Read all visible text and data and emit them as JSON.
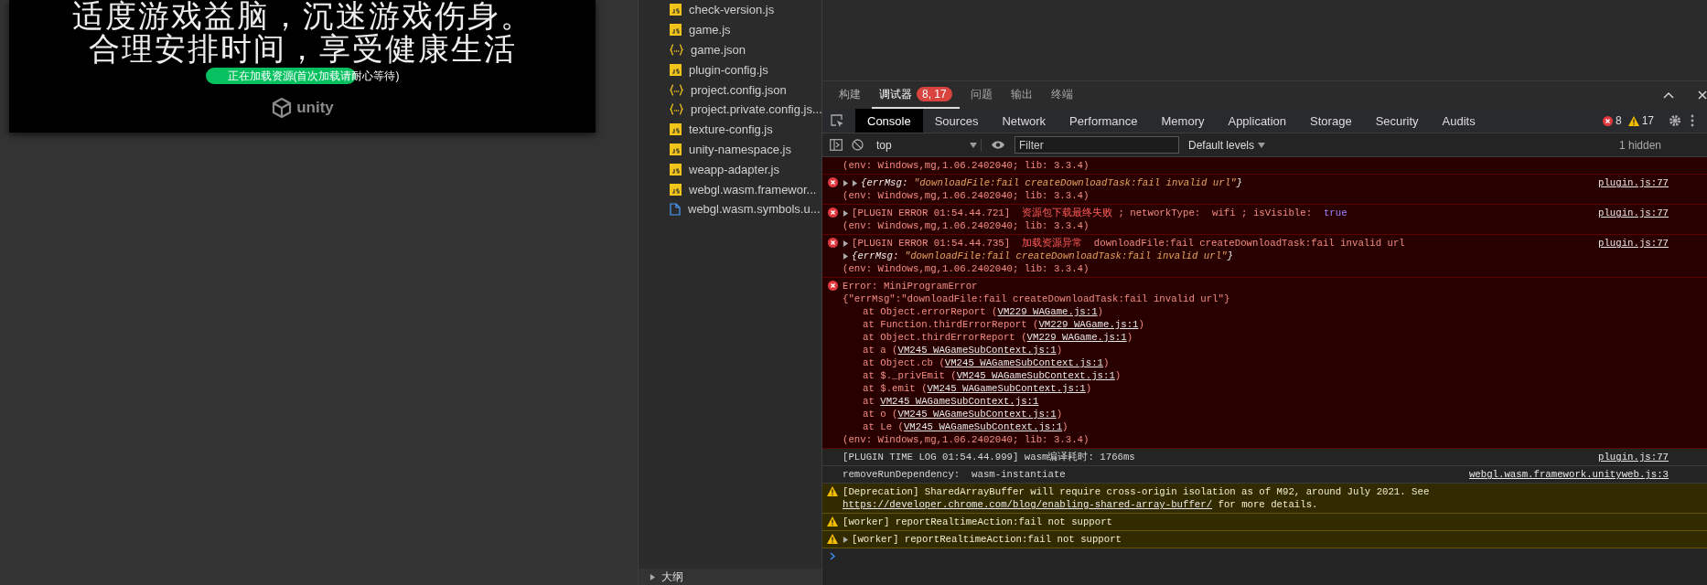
{
  "game": {
    "lines": [
      "适度游戏益脑，沉迷游戏伤身。",
      "合理安排时间，享受健康生活"
    ],
    "loading": "正在加载资源(首次加载请耐心等待)",
    "logo": "unity"
  },
  "files": [
    {
      "name": "check-version.js",
      "kind": "js"
    },
    {
      "name": "game.js",
      "kind": "js"
    },
    {
      "name": "game.json",
      "kind": "json"
    },
    {
      "name": "plugin-config.js",
      "kind": "js"
    },
    {
      "name": "project.config.json",
      "kind": "json"
    },
    {
      "name": "project.private.config.js...",
      "kind": "json"
    },
    {
      "name": "texture-config.js",
      "kind": "js"
    },
    {
      "name": "unity-namespace.js",
      "kind": "js"
    },
    {
      "name": "weapp-adapter.js",
      "kind": "js"
    },
    {
      "name": "webgl.wasm.framewor...",
      "kind": "js"
    },
    {
      "name": "webgl.wasm.symbols.u...",
      "kind": "file"
    }
  ],
  "outline": {
    "label": "大纲",
    "expanded": false
  },
  "panel_tabs": [
    {
      "label": "构建",
      "selected": false
    },
    {
      "label": "调试器",
      "selected": true,
      "badge": "8, 17"
    },
    {
      "label": "问题",
      "selected": false
    },
    {
      "label": "输出",
      "selected": false
    },
    {
      "label": "终端",
      "selected": false
    }
  ],
  "devtools_tabs": [
    {
      "label": "Console",
      "selected": true
    },
    {
      "label": "Sources",
      "selected": false
    },
    {
      "label": "Network",
      "selected": false
    },
    {
      "label": "Performance",
      "selected": false
    },
    {
      "label": "Memory",
      "selected": false
    },
    {
      "label": "Application",
      "selected": false
    },
    {
      "label": "Storage",
      "selected": false
    },
    {
      "label": "Security",
      "selected": false
    },
    {
      "label": "Audits",
      "selected": false
    }
  ],
  "counts": {
    "errors": "8",
    "warnings": "17"
  },
  "console_toolbar": {
    "context": "top",
    "filter_placeholder": "Filter",
    "levels": "Default levels",
    "hidden": "1 hidden"
  },
  "messages": [
    {
      "kind": "error",
      "continued": true,
      "lines": [
        {
          "parts": [
            {
              "kind": "plain",
              "text": "(env: Windows,mg,1.06.2402040; lib: 3.3.4)"
            }
          ]
        }
      ]
    },
    {
      "kind": "error",
      "source": "plugin.js:77",
      "lines": [
        {
          "toggles": [
            {
              "expanded": false
            },
            {
              "expanded": false
            }
          ],
          "parts": [
            {
              "kind": "key",
              "text": "{errMsg: "
            },
            {
              "kind": "string",
              "text": "\"downloadFile:fail createDownloadTask:fail invalid url\""
            },
            {
              "kind": "key",
              "text": "}"
            }
          ]
        },
        {
          "parts": [
            {
              "kind": "plain",
              "text": "(env: Windows,mg,1.06.2402040; lib: 3.3.4)"
            }
          ]
        }
      ]
    },
    {
      "kind": "error",
      "source": "plugin.js:77",
      "lines": [
        {
          "toggles": [
            {
              "expanded": false
            }
          ],
          "parts": [
            {
              "kind": "plain",
              "text": "[PLUGIN ERROR 01:54.44.721]  "
            },
            {
              "kind": "cn",
              "text": "资源包下载最终失败"
            },
            {
              "kind": "plain",
              "text": " ; networkType:  wifi ; isVisible:  "
            },
            {
              "kind": "keyword",
              "text": "true"
            }
          ]
        },
        {
          "parts": [
            {
              "kind": "plain",
              "text": "(env: Windows,mg,1.06.2402040; lib: 3.3.4)"
            }
          ]
        }
      ]
    },
    {
      "kind": "error",
      "source": "plugin.js:77",
      "lines": [
        {
          "toggles": [
            {
              "expanded": false
            }
          ],
          "parts": [
            {
              "kind": "plain",
              "text": "[PLUGIN ERROR 01:54.44.735]  "
            },
            {
              "kind": "cn",
              "text": "加载资源异常"
            },
            {
              "kind": "plain",
              "text": "  downloadFile:fail createDownloadTask:fail invalid url"
            }
          ]
        },
        {
          "toggles": [
            {
              "expanded": false
            }
          ],
          "parts": [
            {
              "kind": "key",
              "text": "{errMsg: "
            },
            {
              "kind": "string",
              "text": "\"downloadFile:fail createDownloadTask:fail invalid url\""
            },
            {
              "kind": "key",
              "text": "}"
            }
          ]
        },
        {
          "parts": [
            {
              "kind": "plain",
              "text": "(env: Windows,mg,1.06.2402040; lib: 3.3.4)"
            }
          ]
        }
      ]
    },
    {
      "kind": "error",
      "lines": [
        {
          "parts": [
            {
              "kind": "plain",
              "text": "Error: MiniProgramError"
            }
          ]
        },
        {
          "parts": [
            {
              "kind": "plain",
              "text": "{\"errMsg\":\"downloadFile:fail createDownloadTask:fail invalid url\"}"
            }
          ]
        }
      ],
      "stack": [
        {
          "parts": [
            {
              "kind": "plain",
              "text": "at Object.errorReport ("
            },
            {
              "kind": "link",
              "text": "VM229 WAGame.js:1"
            },
            {
              "kind": "plain",
              "text": ")"
            }
          ]
        },
        {
          "parts": [
            {
              "kind": "plain",
              "text": "at Function.thirdErrorReport ("
            },
            {
              "kind": "link",
              "text": "VM229 WAGame.js:1"
            },
            {
              "kind": "plain",
              "text": ")"
            }
          ]
        },
        {
          "parts": [
            {
              "kind": "plain",
              "text": "at Object.thirdErrorReport ("
            },
            {
              "kind": "link",
              "text": "VM229 WAGame.js:1"
            },
            {
              "kind": "plain",
              "text": ")"
            }
          ]
        },
        {
          "parts": [
            {
              "kind": "plain",
              "text": "at a ("
            },
            {
              "kind": "link",
              "text": "VM245 WAGameSubContext.js:1"
            },
            {
              "kind": "plain",
              "text": ")"
            }
          ]
        },
        {
          "parts": [
            {
              "kind": "plain",
              "text": "at Object.cb ("
            },
            {
              "kind": "link",
              "text": "VM245 WAGameSubContext.js:1"
            },
            {
              "kind": "plain",
              "text": ")"
            }
          ]
        },
        {
          "parts": [
            {
              "kind": "plain",
              "text": "at $._privEmit ("
            },
            {
              "kind": "link",
              "text": "VM245 WAGameSubContext.js:1"
            },
            {
              "kind": "plain",
              "text": ")"
            }
          ]
        },
        {
          "parts": [
            {
              "kind": "plain",
              "text": "at $.emit ("
            },
            {
              "kind": "link",
              "text": "VM245 WAGameSubContext.js:1"
            },
            {
              "kind": "plain",
              "text": ")"
            }
          ]
        },
        {
          "parts": [
            {
              "kind": "plain",
              "text": "at "
            },
            {
              "kind": "link",
              "text": "VM245 WAGameSubContext.js:1"
            }
          ]
        },
        {
          "parts": [
            {
              "kind": "plain",
              "text": "at o ("
            },
            {
              "kind": "link",
              "text": "VM245 WAGameSubContext.js:1"
            },
            {
              "kind": "plain",
              "text": ")"
            }
          ]
        },
        {
          "parts": [
            {
              "kind": "plain",
              "text": "at Le ("
            },
            {
              "kind": "link",
              "text": "VM245 WAGameSubContext.js:1"
            },
            {
              "kind": "plain",
              "text": ")"
            }
          ]
        }
      ],
      "tail": [
        {
          "parts": [
            {
              "kind": "plain",
              "text": "(env: Windows,mg,1.06.2402040; lib: 3.3.4)"
            }
          ]
        }
      ]
    },
    {
      "kind": "log",
      "source": "plugin.js:77",
      "lines": [
        {
          "parts": [
            {
              "kind": "plain",
              "text": "[PLUGIN TIME LOG 01:54.44.999] wasm编译耗时: 1766ms"
            }
          ]
        }
      ]
    },
    {
      "kind": "log",
      "source": "webgl.wasm.framework.unityweb.js:3",
      "lines": [
        {
          "parts": [
            {
              "kind": "plain",
              "text": "removeRunDependency:  wasm-instantiate"
            }
          ]
        }
      ]
    },
    {
      "kind": "warning",
      "lines": [
        {
          "parts": [
            {
              "kind": "plain",
              "text": "[Deprecation] SharedArrayBuffer will require cross-origin isolation as of M92, around July 2021. See "
            },
            {
              "kind": "link",
              "text": "https://developer.chrome.com/blog/enabling-shared-array-buffer/"
            },
            {
              "kind": "plain",
              "text": " for more details."
            }
          ]
        }
      ]
    },
    {
      "kind": "warning",
      "lines": [
        {
          "parts": [
            {
              "kind": "plain",
              "text": "[worker] reportRealtimeAction:fail not support"
            }
          ]
        }
      ]
    },
    {
      "kind": "warning",
      "lines": [
        {
          "toggles": [
            {
              "expanded": false
            }
          ],
          "parts": [
            {
              "kind": "plain",
              "text": "[worker] reportRealtimeAction:fail not support"
            }
          ]
        }
      ]
    }
  ]
}
